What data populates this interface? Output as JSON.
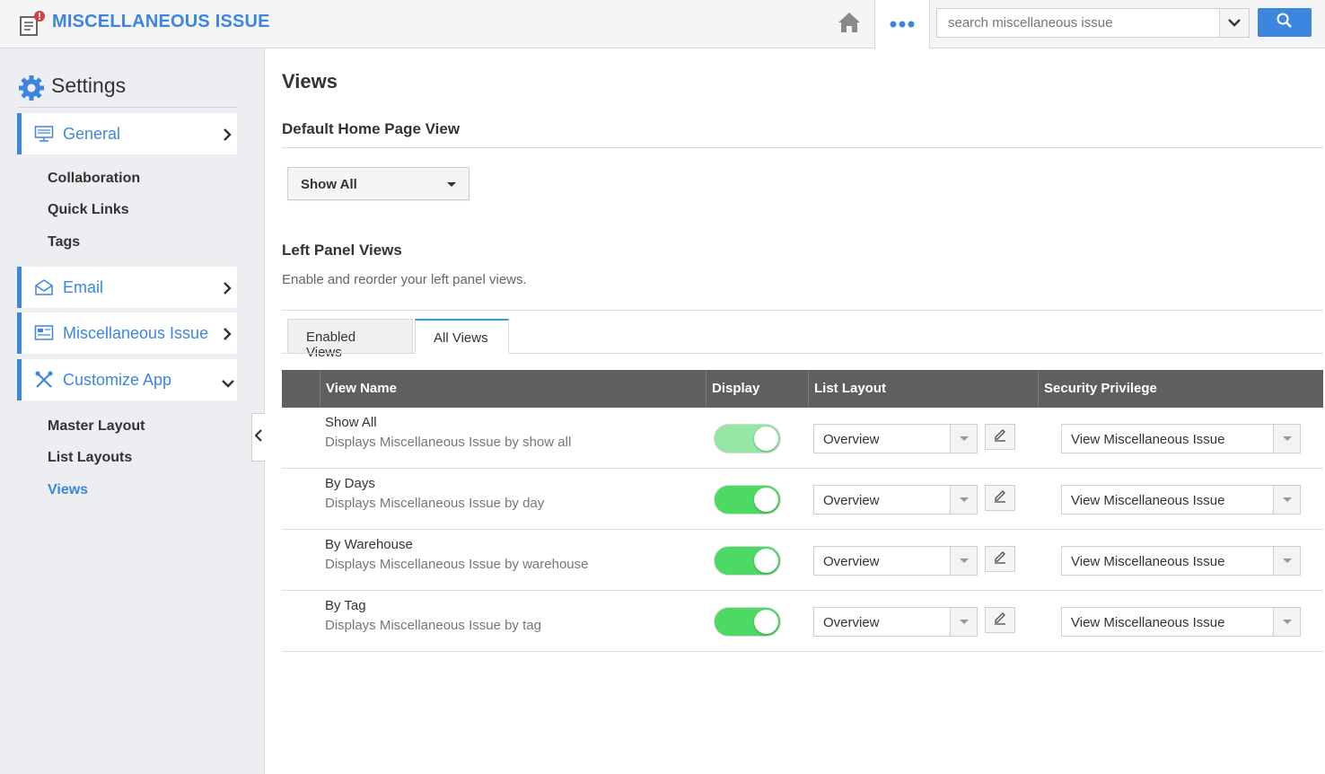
{
  "header": {
    "app_title": "MISCELLANEOUS ISSUE",
    "search_placeholder": "search miscellaneous issue",
    "icons": [
      "app-logo-icon",
      "home-icon",
      "more-dots-icon",
      "chevron-down-icon",
      "search-icon"
    ]
  },
  "sidebar": {
    "title": "Settings",
    "menu": [
      {
        "label": "General",
        "icon": "monitor-icon",
        "expanded": false
      },
      {
        "label": "Email",
        "icon": "envelope-icon",
        "expanded": false
      },
      {
        "label": "Miscellaneous Issue",
        "icon": "document-icon",
        "expanded": false
      },
      {
        "label": "Customize App",
        "icon": "tools-icon",
        "expanded": true
      }
    ],
    "general_sub": [
      "Collaboration",
      "Quick Links",
      "Tags"
    ],
    "customize_sub": [
      "Master Layout",
      "List Layouts",
      "Views"
    ],
    "active_sub": "Views"
  },
  "main": {
    "title": "Views",
    "default_section_title": "Default Home Page View",
    "default_view_value": "Show All",
    "left_panel_title": "Left Panel Views",
    "left_panel_desc": "Enable and reorder your left panel views.",
    "tabs": [
      "Enabled Views",
      "All Views"
    ],
    "active_tab": "All Views",
    "table": {
      "headers": [
        "View Name",
        "Display",
        "List Layout",
        "Security Privilege"
      ],
      "rows": [
        {
          "name": "Show All",
          "desc": "Displays Miscellaneous Issue by show all",
          "display": true,
          "layout": "Overview",
          "privilege": "View Miscellaneous Issue"
        },
        {
          "name": "By Days",
          "desc": "Displays Miscellaneous Issue by day",
          "display": true,
          "layout": "Overview",
          "privilege": "View Miscellaneous Issue"
        },
        {
          "name": "By Warehouse",
          "desc": "Displays Miscellaneous Issue by warehouse",
          "display": true,
          "layout": "Overview",
          "privilege": "View Miscellaneous Issue"
        },
        {
          "name": "By Tag",
          "desc": "Displays Miscellaneous Issue by tag",
          "display": true,
          "layout": "Overview",
          "privilege": "View Miscellaneous Issue"
        }
      ]
    }
  },
  "colors": {
    "accent": "#3d86e0",
    "toggle_on": "#4cd964",
    "table_header": "#5f5f5f"
  }
}
